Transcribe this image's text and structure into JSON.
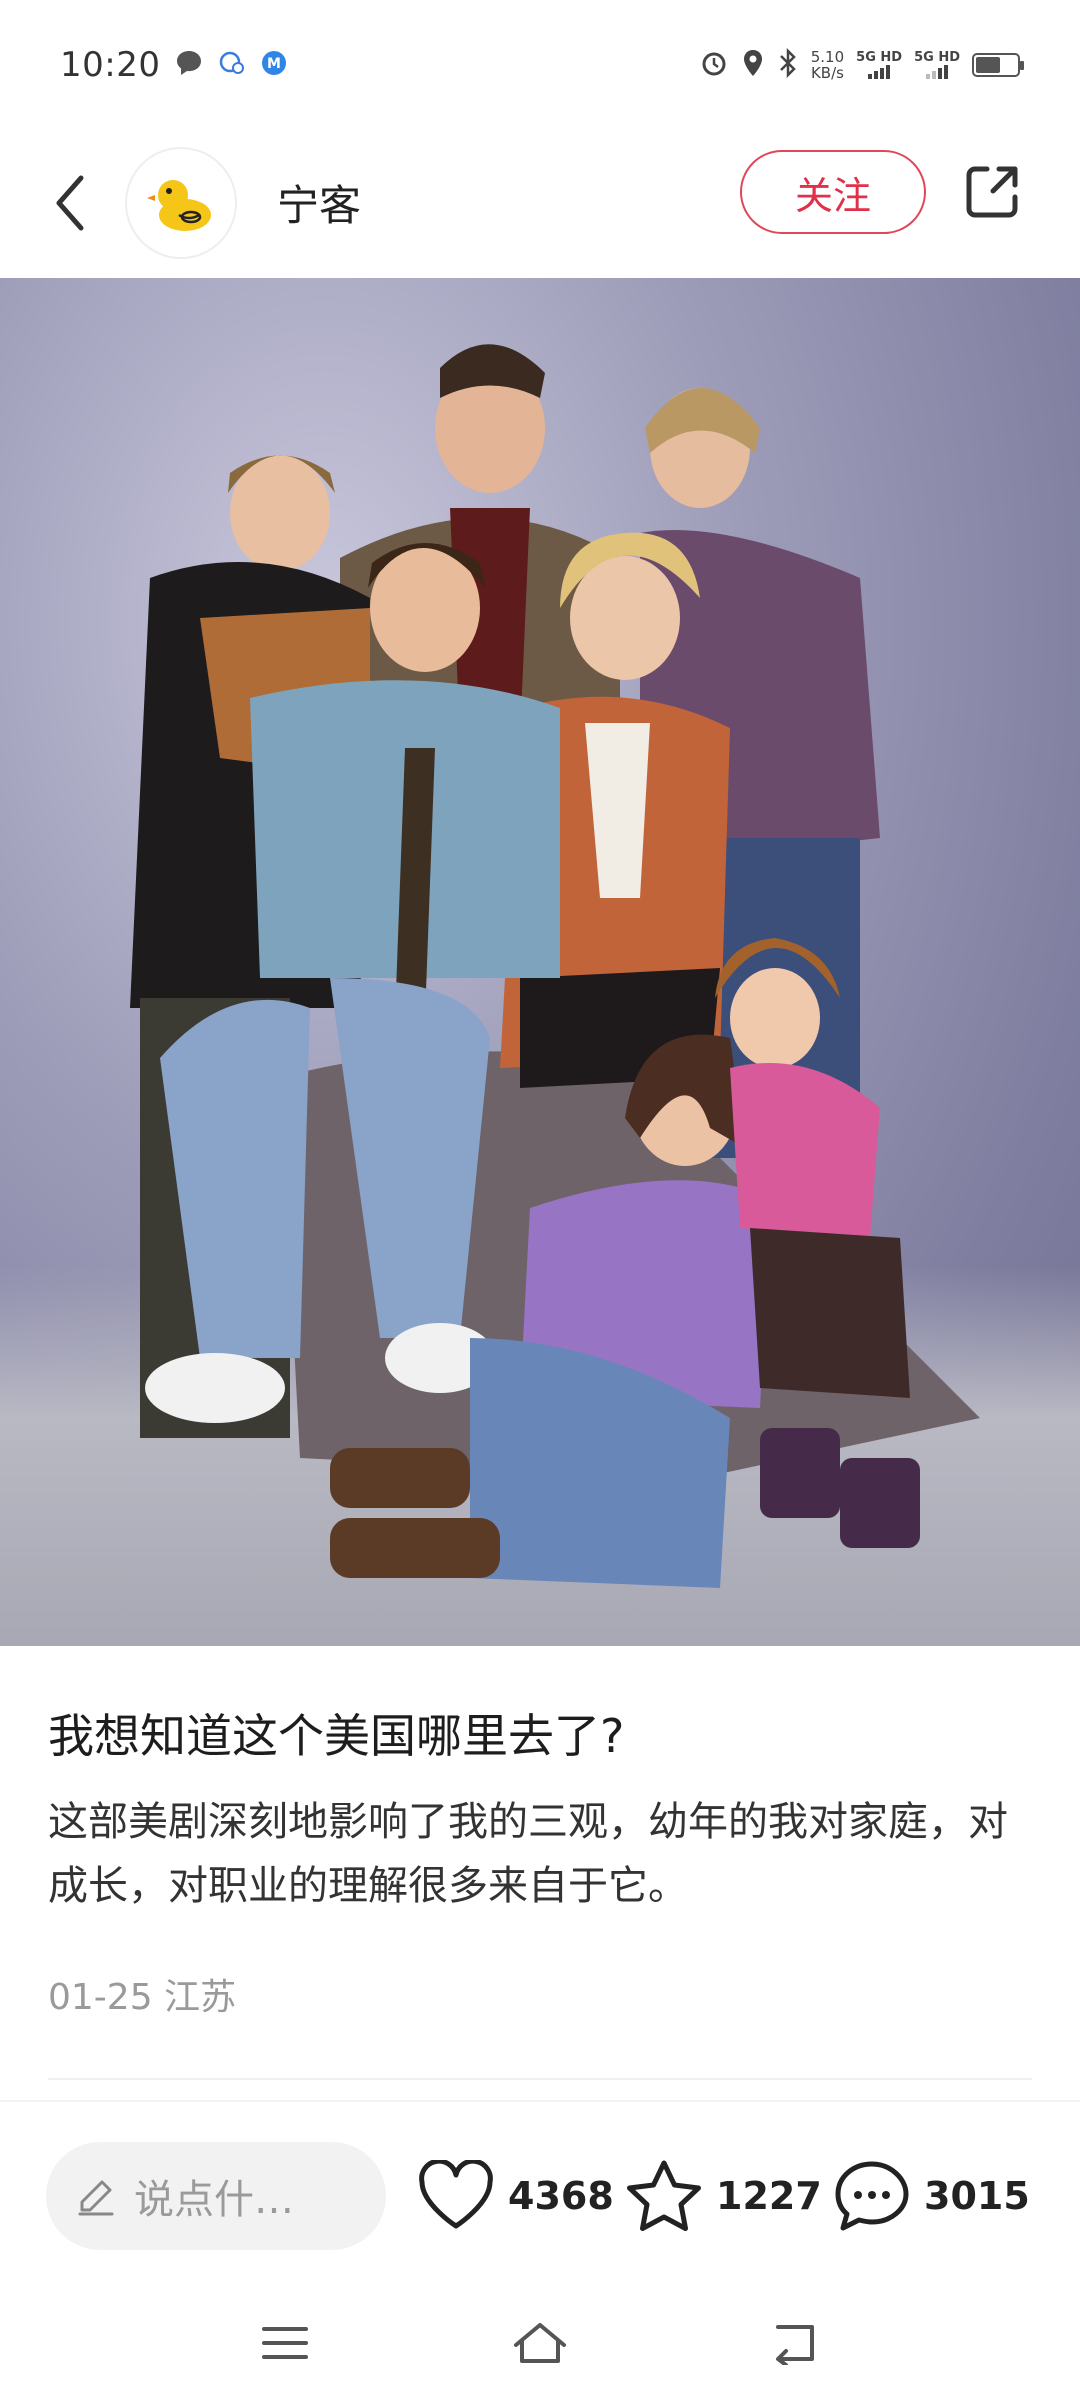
{
  "status_bar": {
    "time": "10:20",
    "speed_value": "5.10",
    "speed_unit": "KB/s",
    "net1": "5G HD",
    "net2": "5G HD"
  },
  "header": {
    "username": "宁客",
    "follow_label": "关注"
  },
  "post": {
    "title": "我想知道这个美国哪里去了?",
    "body": "这部美剧深刻地影响了我的三观，幼年的我对家庭，对成长，对职业的理解很多来自于它。",
    "date": "01-25",
    "location": "江苏"
  },
  "actions": {
    "comment_placeholder": "说点什…",
    "likes": "4368",
    "favorites": "1227",
    "comments": "3015"
  },
  "colors": {
    "accent": "#e0304a",
    "input_bg": "#f2f2f2"
  },
  "icons": [
    "back-icon",
    "duck-avatar-icon",
    "share-icon",
    "pencil-icon",
    "heart-icon",
    "star-icon",
    "comment-icon",
    "menu-icon",
    "home-icon",
    "return-icon"
  ]
}
